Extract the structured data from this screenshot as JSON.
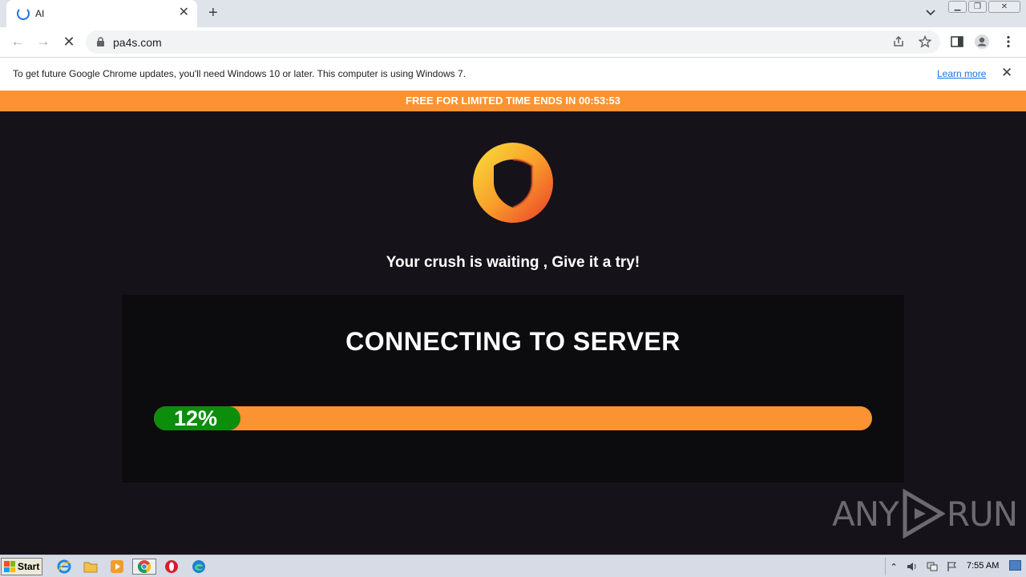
{
  "browser": {
    "tab": {
      "title": "AI",
      "close_icon": "close-icon"
    },
    "url": "pa4s.com",
    "infobar": {
      "message": "To get future Google Chrome updates, you'll need Windows 10 or later. This computer is using Windows 7.",
      "link": "Learn more"
    }
  },
  "page": {
    "banner": "FREE FOR LIMITED TIME ENDS IN 00:53:53",
    "tagline": "Your crush is waiting , Give it a try!",
    "panel_title": "CONNECTING TO SERVER",
    "progress": {
      "label": "12%",
      "value": 12
    },
    "colors": {
      "accent": "#fc9332",
      "progress_fill": "#0c8d0c",
      "background": "#16121a"
    }
  },
  "watermark": {
    "left": "ANY",
    "right": "RUN"
  },
  "taskbar": {
    "start_label": "Start",
    "clock": "7:55 AM",
    "apps": [
      "internet-explorer-icon",
      "folder-icon",
      "media-player-icon",
      "chrome-icon",
      "opera-icon",
      "edge-icon"
    ]
  }
}
